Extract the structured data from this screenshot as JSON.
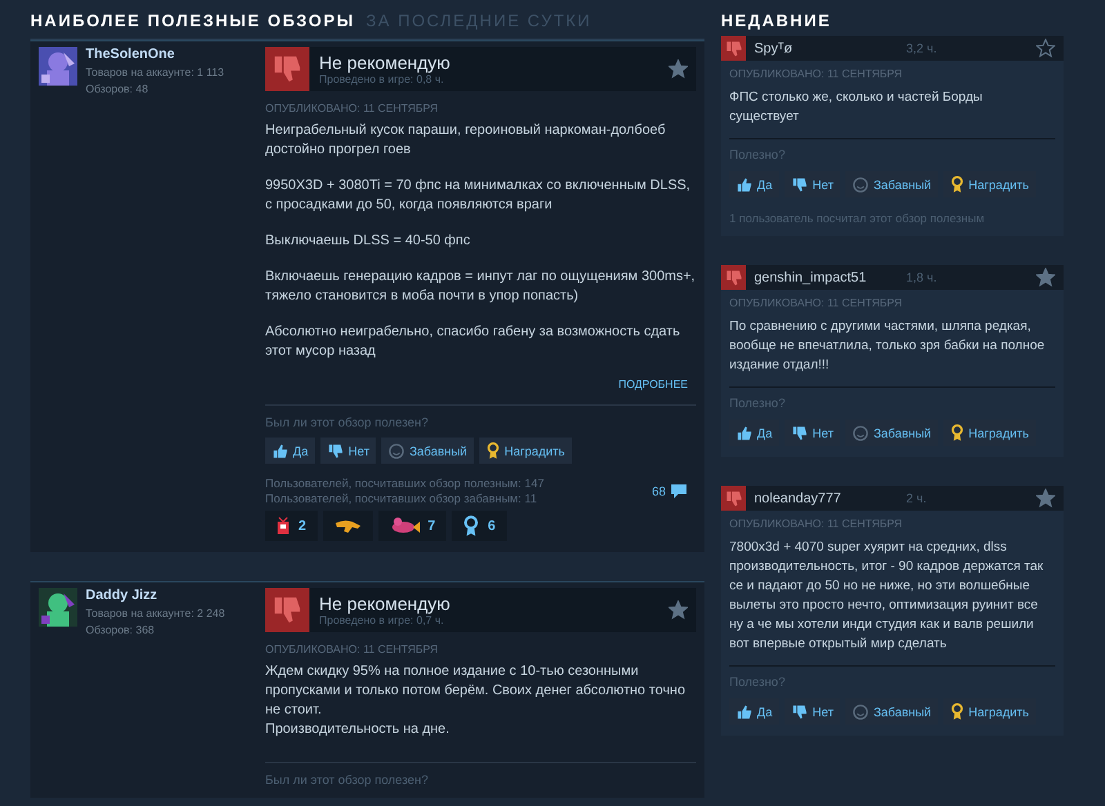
{
  "header": {
    "title": "НАИБОЛЕЕ ПОЛЕЗНЫЕ ОБЗОРЫ",
    "subtitle": "ЗА ПОСЛЕДНИЕ СУТКИ"
  },
  "reviews": [
    {
      "author": "TheSolenOne",
      "games": "Товаров на аккаунте: 1 113",
      "reviews_count": "Обзоров: 48",
      "verdict": "Не рекомендую",
      "playtime": "Проведено в игре: 0,8 ч.",
      "starred": true,
      "posted": "ОПУБЛИКОВАНО: 11 СЕНТЯБРЯ",
      "paragraphs": [
        "Неиграбельный кусок параши, героиновый наркоман-долбоеб достойно прогрел гоев",
        "9950X3D + 3080Ti = 70 фпс на минималках со включенным DLSS, с просадками до 50, когда появляются враги",
        "Выключаешь DLSS = 40-50 фпс",
        "Включаешь генерацию кадров = инпут лаг по ощущениям 300ms+, тяжело становится в моба почти в упор попасть)",
        "Абсолютно неиграбельно, спасибо габену за возможность сдать этот мусор назад"
      ],
      "read_more": "ПОДРОБНЕЕ",
      "question": "Был ли этот обзор полезен?",
      "buttons": [
        {
          "kind": "yes",
          "label": "Да"
        },
        {
          "kind": "no",
          "label": "Нет"
        },
        {
          "kind": "funny",
          "label": "Забавный"
        },
        {
          "kind": "award",
          "label": "Наградить"
        }
      ],
      "helpful": "Пользователей, посчитавших обзор полезным: 147",
      "funny": "Пользователей, посчитавших обзор забавным: 11",
      "comments": "68",
      "awards": [
        {
          "kind": "gift",
          "count": "2"
        },
        {
          "kind": "hand"
        },
        {
          "kind": "fish",
          "count": "7"
        },
        {
          "kind": "medal",
          "count": "6"
        }
      ]
    },
    {
      "author": "Daddy Jizz",
      "games": "Товаров на аккаунте: 2 248",
      "reviews_count": "Обзоров: 368",
      "verdict": "Не рекомендую",
      "playtime": "Проведено в игре: 0,7 ч.",
      "starred": true,
      "posted": "ОПУБЛИКОВАНО: 11 СЕНТЯБРЯ",
      "paragraphs": [
        "Ждем скидку 95% на полное издание с 10-тью сезонными пропусками и только потом берём. Своих денег абсолютно точно не стоит.\nПроизводительность на дне."
      ],
      "question": "Был ли этот обзор полезен?"
    }
  ],
  "recent": {
    "title": "НЕДАВНИЕ",
    "items": [
      {
        "author": "Spyᵀø",
        "hours": "3,2 ч.",
        "starred": false,
        "posted": "ОПУБЛИКОВАНО: 11 СЕНТЯБРЯ",
        "text": "ФПС столько же, сколько и частей Борды существует",
        "question": "Полезно?",
        "buttons": [
          {
            "kind": "yes",
            "label": "Да"
          },
          {
            "kind": "no",
            "label": "Нет"
          },
          {
            "kind": "funny",
            "label": "Забавный"
          },
          {
            "kind": "award",
            "label": "Наградить"
          }
        ],
        "helpful": "1 пользователь посчитал этот обзор полезным"
      },
      {
        "author": "genshin_impact51",
        "hours": "1,8 ч.",
        "starred": true,
        "posted": "ОПУБЛИКОВАНО: 11 СЕНТЯБРЯ",
        "text": "По сравнению с другими частями, шляпа редкая, вообще не впечатлила, только зря бабки на полное издание отдал!!!",
        "question": "Полезно?",
        "buttons": [
          {
            "kind": "yes",
            "label": "Да"
          },
          {
            "kind": "no",
            "label": "Нет"
          },
          {
            "kind": "funny",
            "label": "Забавный"
          },
          {
            "kind": "award",
            "label": "Наградить"
          }
        ]
      },
      {
        "author": "noleanday777",
        "hours": "2 ч.",
        "starred": true,
        "posted": "ОПУБЛИКОВАНО: 11 СЕНТЯБРЯ",
        "text": "7800x3d + 4070 super хуярит на средних, dlss производительность, итог - 90 кадров держатся так се и падают до 50 но не ниже, но эти волшебные вылеты это просто нечто, оптимизация руинит все ну а че мы хотели инди студия как и валв решили вот впервые открытый мир сделать",
        "question": "Полезно?",
        "buttons": [
          {
            "kind": "yes",
            "label": "Да"
          },
          {
            "kind": "no",
            "label": "Нет"
          },
          {
            "kind": "funny",
            "label": "Забавный"
          },
          {
            "kind": "award",
            "label": "Наградить"
          }
        ]
      }
    ]
  }
}
